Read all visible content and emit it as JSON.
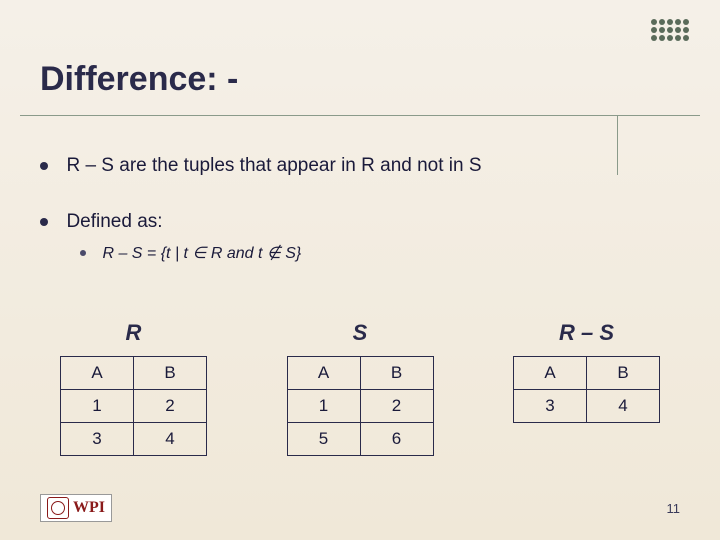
{
  "title": "Difference: -",
  "bullets": {
    "b1": "R – S are the tuples that appear in R and not in S",
    "b2": "Defined as:",
    "b3": "R – S = {t | t ∈ R and t ∉ S}"
  },
  "tables": {
    "R": {
      "name": "R",
      "headers": [
        "A",
        "B"
      ],
      "rows": [
        [
          "1",
          "2"
        ],
        [
          "3",
          "4"
        ]
      ]
    },
    "S": {
      "name": "S",
      "headers": [
        "A",
        "B"
      ],
      "rows": [
        [
          "1",
          "2"
        ],
        [
          "5",
          "6"
        ]
      ]
    },
    "RS": {
      "name": "R – S",
      "headers": [
        "A",
        "B"
      ],
      "rows": [
        [
          "3",
          "4"
        ]
      ]
    }
  },
  "logo": "WPI",
  "page_number": "11"
}
